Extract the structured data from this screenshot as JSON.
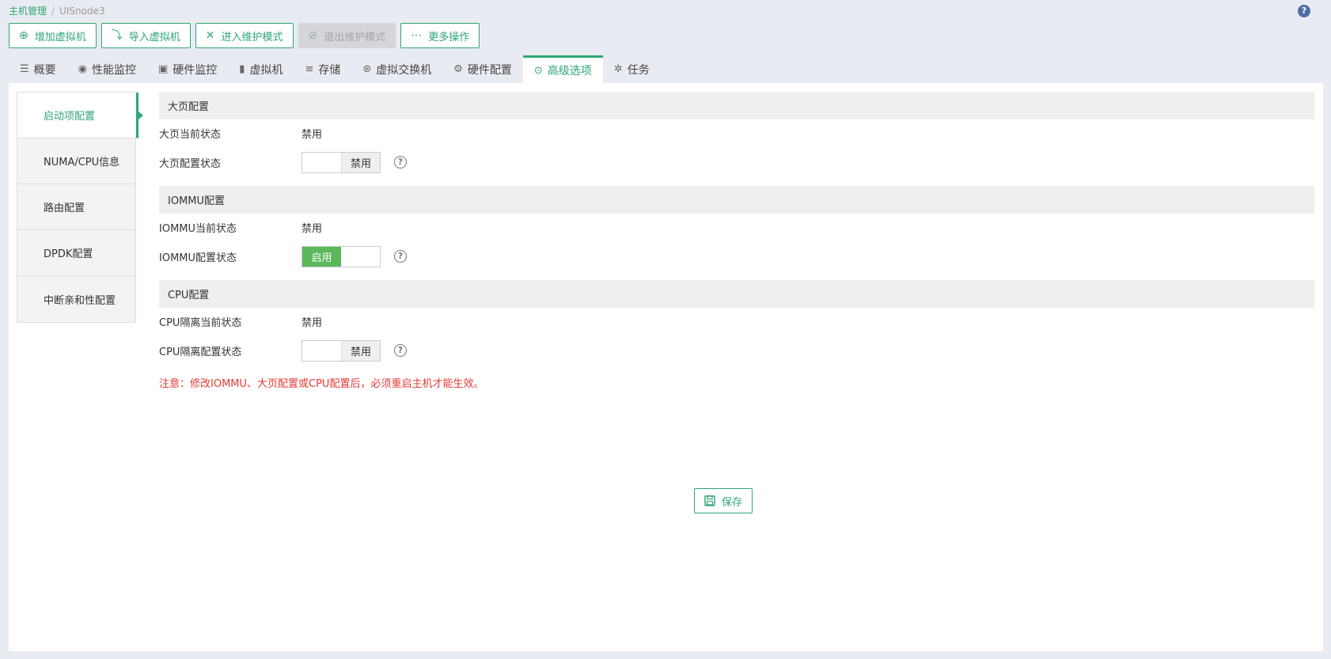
{
  "breadcrumb": {
    "root": "主机管理",
    "separator": "/",
    "current": "UISnode3"
  },
  "help": "?",
  "toolbar": {
    "add_vm": {
      "label": "增加虚拟机",
      "icon": "plus-circle-icon"
    },
    "import_vm": {
      "label": "导入虚拟机",
      "icon": "import-icon"
    },
    "enter_maintenance": {
      "label": "进入维护模式",
      "icon": "tools-icon"
    },
    "exit_maintenance": {
      "label": "退出维护模式",
      "icon": "exit-maintenance-icon"
    },
    "more": {
      "label": "更多操作",
      "icon": "ellipsis-icon"
    }
  },
  "tabs": [
    {
      "label": "概要",
      "icon": "list-icon"
    },
    {
      "label": "性能监控",
      "icon": "monitor-icon"
    },
    {
      "label": "硬件监控",
      "icon": "chart-icon"
    },
    {
      "label": "虚拟机",
      "icon": "vm-icon"
    },
    {
      "label": "存储",
      "icon": "database-icon"
    },
    {
      "label": "虚拟交换机",
      "icon": "switch-icon"
    },
    {
      "label": "硬件配置",
      "icon": "gear-icon"
    },
    {
      "label": "高级选项",
      "icon": "advanced-icon",
      "active": true
    },
    {
      "label": "任务",
      "icon": "task-icon"
    }
  ],
  "sidenav": [
    {
      "label": "启动项配置",
      "active": true
    },
    {
      "label": "NUMA/CPU信息"
    },
    {
      "label": "路由配置"
    },
    {
      "label": "DPDK配置"
    },
    {
      "label": "中断亲和性配置"
    }
  ],
  "sections": {
    "hugepage": {
      "title": "大页配置",
      "current_label": "大页当前状态",
      "current_value": "禁用",
      "config_label": "大页配置状态",
      "switch_off": "禁用"
    },
    "iommu": {
      "title": "IOMMU配置",
      "current_label": "IOMMU当前状态",
      "current_value": "禁用",
      "config_label": "IOMMU配置状态",
      "switch_on": "启用"
    },
    "cpu": {
      "title": "CPU配置",
      "current_label": "CPU隔离当前状态",
      "current_value": "禁用",
      "config_label": "CPU隔离配置状态",
      "switch_off": "禁用"
    }
  },
  "qmark": "?",
  "notice": "注意：修改IOMMU、大页配置或CPU配置后，必须重启主机才能生效。",
  "save_label": "保存",
  "colors": {
    "accent": "#2fa676",
    "switch_on": "#5cb85c",
    "notice": "#e53935"
  }
}
